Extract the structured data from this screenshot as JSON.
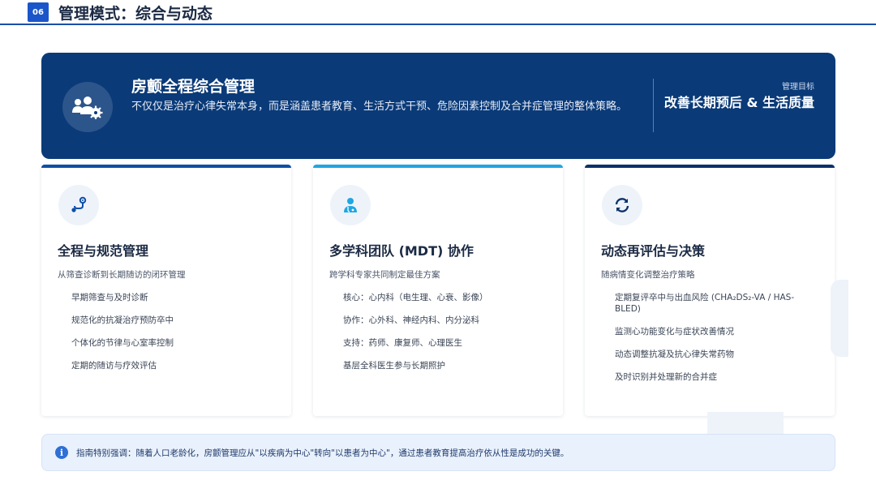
{
  "header": {
    "badge": "06",
    "title": "管理模式：综合与动态"
  },
  "hero": {
    "icon": "user-group-gear-icon",
    "title": "房颤全程综合管理",
    "description": "不仅仅是治疗心律失常本身，而是涵盖患者教育、生活方式干预、危险因素控制及合并症管理的整体策略。",
    "goal_label": "管理目标",
    "goal_value": "改善长期预后 & 生活质量"
  },
  "cards": [
    {
      "icon": "route-icon",
      "accent": "#0d4fa8",
      "title": "全程与规范管理",
      "subtitle": "从筛查诊断到长期随访的闭环管理",
      "items": [
        "早期筛查与及时诊断",
        "规范化的抗凝治疗预防卒中",
        "个体化的节律与心室率控制",
        "定期的随访与疗效评估"
      ]
    },
    {
      "icon": "doctor-icon",
      "accent": "#1ea7e1",
      "title": "多学科团队 (MDT) 协作",
      "subtitle": "跨学科专家共同制定最佳方案",
      "items": [
        "核心：心内科（电生理、心衰、影像）",
        "协作：心外科、神经内科、内分泌科",
        "支持：药师、康复师、心理医生",
        "基层全科医生参与长期照护"
      ]
    },
    {
      "icon": "refresh-icon",
      "accent": "#0a3168",
      "title": "动态再评估与决策",
      "subtitle": "随病情变化调整治疗策略",
      "items": [
        "定期复评卒中与出血风险 (CHA₂DS₂-VA / HAS-BLED)",
        "监测心功能变化与症状改善情况",
        "动态调整抗凝及抗心律失常药物",
        "及时识别并处理新的合并症"
      ]
    }
  ],
  "note": {
    "icon": "info-icon",
    "text": "指南特别强调：随着人口老龄化，房颤管理应从\"以疾病为中心\"转向\"以患者为中心\"，通过患者教育提高治疗依从性是成功的关键。"
  },
  "colors": {
    "primary": "#0a3a78",
    "accent_blue": "#1a56c9",
    "cyan": "#1ea7e1"
  }
}
